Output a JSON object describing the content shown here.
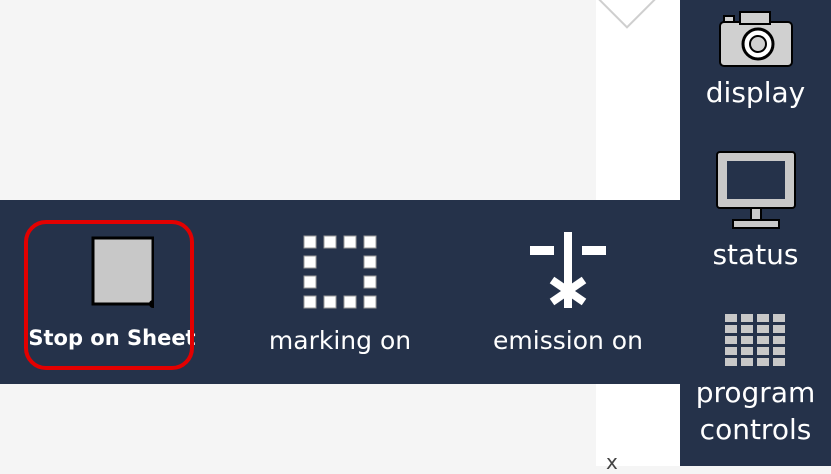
{
  "toolbar": {
    "items": [
      {
        "label": "Stop on Sheet",
        "icon": "sheet-stop-icon",
        "selected": true
      },
      {
        "label": "marking on",
        "icon": "marking-frame-icon",
        "selected": false
      },
      {
        "label": "emission on",
        "icon": "emission-icon",
        "selected": false
      }
    ]
  },
  "sidebar": {
    "items": [
      {
        "label": "display",
        "icon": "camera-icon"
      },
      {
        "label": "status",
        "icon": "monitor-icon"
      },
      {
        "label": "program\ncontrols",
        "label_line1": "program",
        "label_line2": "controls",
        "icon": "grid-table-icon"
      }
    ]
  },
  "canvas": {
    "axis_marker": "x"
  },
  "colors": {
    "panel": "#25324a",
    "highlight": "#e30000",
    "background": "#f5f5f5",
    "icon_fill": "#c8c8c8"
  }
}
